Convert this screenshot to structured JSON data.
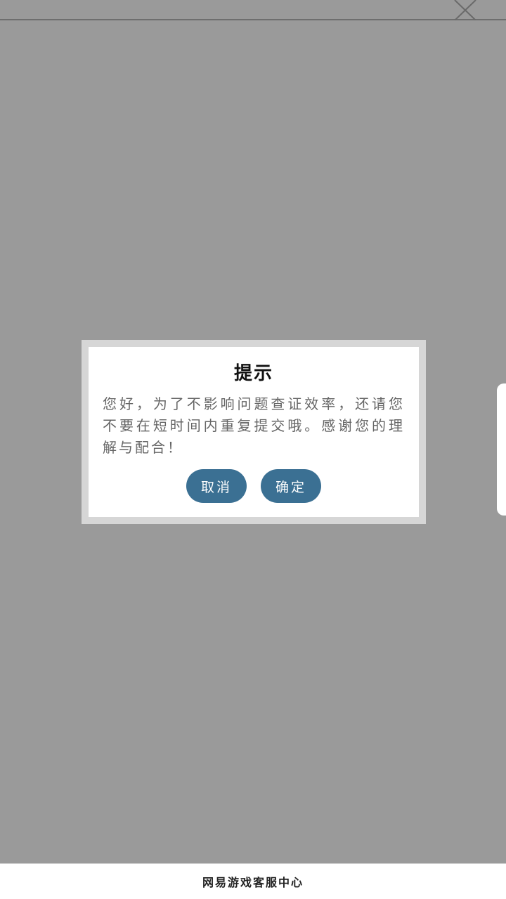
{
  "header": {
    "close_icon": "close-icon"
  },
  "dialog": {
    "title": "提示",
    "message": "您好，为了不影响问题查证效率，还请您不要在短时间内重复提交哦。感谢您的理解与配合！",
    "cancel_label": "取消",
    "confirm_label": "确定"
  },
  "footer": {
    "text": "网易游戏客服中心"
  },
  "colors": {
    "overlay": "#9a9a9a",
    "button": "#3b7093",
    "dialog_border": "#d6d6d6"
  }
}
